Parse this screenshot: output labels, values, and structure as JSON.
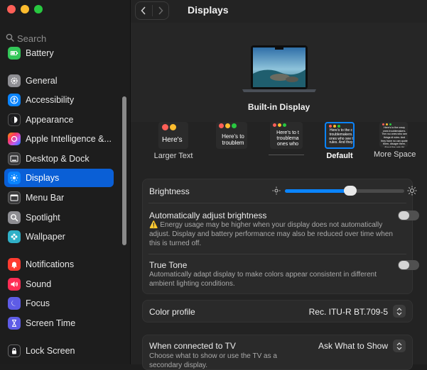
{
  "sidebar": {
    "search_placeholder": "Search",
    "items": [
      {
        "label": "Battery",
        "icon": "battery-icon",
        "color": "#33c759"
      },
      {
        "label": "General",
        "icon": "gear-icon",
        "color": "#8e8e93"
      },
      {
        "label": "Accessibility",
        "icon": "accessibility-icon",
        "color": "#0a84ff"
      },
      {
        "label": "Appearance",
        "icon": "appearance-icon",
        "color": "#1c1c1e"
      },
      {
        "label": "Apple Intelligence &...",
        "icon": "apple-intelligence-icon",
        "color": "#ff7aa9"
      },
      {
        "label": "Desktop & Dock",
        "icon": "dock-icon",
        "color": "#3a3a3c"
      },
      {
        "label": "Displays",
        "icon": "sun-icon",
        "color": "#0a84ff"
      },
      {
        "label": "Menu Bar",
        "icon": "menubar-icon",
        "color": "#3a3a3c"
      },
      {
        "label": "Spotlight",
        "icon": "magnifier-icon",
        "color": "#8e8e93"
      },
      {
        "label": "Wallpaper",
        "icon": "flower-icon",
        "color": "#30b0c7"
      },
      {
        "label": "Notifications",
        "icon": "bell-icon",
        "color": "#ff3b30"
      },
      {
        "label": "Sound",
        "icon": "speaker-icon",
        "color": "#ff2d55"
      },
      {
        "label": "Focus",
        "icon": "moon-icon",
        "color": "#5e5ce6"
      },
      {
        "label": "Screen Time",
        "icon": "hourglass-icon",
        "color": "#5e5ce6"
      },
      {
        "label": "Lock Screen",
        "icon": "lock-icon",
        "color": "#1c1c1e"
      }
    ],
    "active": "Displays"
  },
  "toolbar": {
    "title": "Displays"
  },
  "display": {
    "name": "Built-in Display"
  },
  "resolution": {
    "options": [
      {
        "label": "Larger Text",
        "preview_text": "Here's"
      },
      {
        "label": "",
        "preview_text": "Here's to troublem"
      },
      {
        "label": "",
        "preview_text": "Here's to t troublema ones who"
      },
      {
        "label": "Default",
        "preview_text": "Here's to the c troublemakers. ones who see t rules. And they"
      },
      {
        "label": "More Space",
        "preview_text": "Here's to the crazy ones troublemakers. The rou ones who see things di rules. And they have no can quote them, disagre them. About the only thi Because they change th"
      }
    ],
    "selected": "Default"
  },
  "brightness": {
    "label": "Brightness",
    "value": 0.55
  },
  "auto_brightness": {
    "label": "Automatically adjust brightness",
    "warning": "Energy usage may be higher when your display does not automatically adjust. Display and battery performance may also be reduced over time when this is turned off.",
    "on": false
  },
  "true_tone": {
    "label": "True Tone",
    "description": "Automatically adapt display to make colors appear consistent in different ambient lighting conditions.",
    "on": false
  },
  "color_profile": {
    "label": "Color profile",
    "value": "Rec. ITU-R BT.709-5"
  },
  "tv": {
    "label": "When connected to TV",
    "description": "Choose what to show or use the TV as a secondary display.",
    "value": "Ask What to Show"
  }
}
